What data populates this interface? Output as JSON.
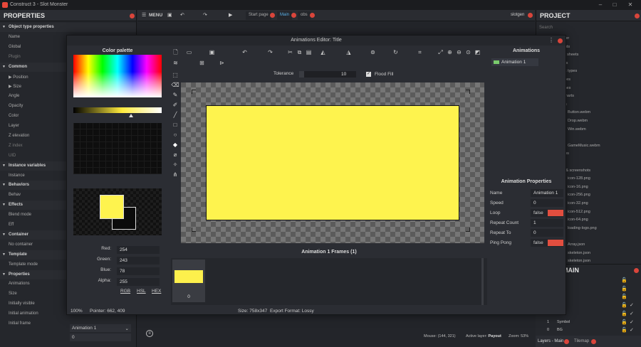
{
  "app": {
    "title": "Construct 3 - Slot Monster",
    "main_menu_label": "MENU",
    "tabs": [
      "Start page",
      "Main",
      "obs"
    ],
    "user": "slotgen",
    "status_mouse": "Mouse: (144, 321)",
    "status_layer_label": "Active layer:",
    "status_layer_value": "Payout",
    "status_zoom": "Zoom: 53%"
  },
  "properties": {
    "title": "PROPERTIES",
    "rows": [
      {
        "label": "Object type properties",
        "type": "section"
      },
      {
        "label": "Name",
        "type": "row"
      },
      {
        "label": "Global",
        "type": "row"
      },
      {
        "label": "Plugin",
        "type": "dim"
      },
      {
        "label": "Common",
        "type": "section"
      },
      {
        "label": "▶  Position",
        "type": "row"
      },
      {
        "label": "▶  Size",
        "type": "row"
      },
      {
        "label": "Angle",
        "type": "row"
      },
      {
        "label": "Opacity",
        "type": "row"
      },
      {
        "label": "Color",
        "type": "row"
      },
      {
        "label": "Layer",
        "type": "row"
      },
      {
        "label": "Z elevation",
        "type": "row"
      },
      {
        "label": "Z index",
        "type": "dim"
      },
      {
        "label": "UID",
        "type": "dim"
      },
      {
        "label": "Instance variables",
        "type": "section"
      },
      {
        "label": "Instance",
        "type": "row"
      },
      {
        "label": "Behaviors",
        "type": "section"
      },
      {
        "label": "Behav",
        "type": "row"
      },
      {
        "label": "Effects",
        "type": "section"
      },
      {
        "label": "Blend mode",
        "type": "row"
      },
      {
        "label": "Eff",
        "type": "row"
      },
      {
        "label": "Container",
        "type": "section"
      },
      {
        "label": "No container",
        "type": "row"
      },
      {
        "label": "Template",
        "type": "section"
      },
      {
        "label": "Template mode",
        "type": "row"
      },
      {
        "label": "Properties",
        "type": "section"
      },
      {
        "label": "Animations",
        "type": "row"
      },
      {
        "label": "Size",
        "type": "row"
      },
      {
        "label": "Initially visible",
        "type": "row"
      },
      {
        "label": "Initial animation",
        "type": "row"
      },
      {
        "label": "Initial frame",
        "type": "row"
      }
    ],
    "initial_animation_value": "Animation 1",
    "initial_frame_value": "0"
  },
  "project": {
    "title": "PROJECT",
    "search_placeholder": "Search",
    "items": [
      "nster",
      "youts",
      "ent sheets",
      "ripts",
      "ject types",
      "milies",
      "elines",
      "wcharts",
      "nds",
      "Button.webm",
      "Drop.webm",
      "Win.webm",
      "sic",
      "GameMusic.webm",
      "deos",
      "nts",
      "ns & screenshots",
      "icon-128.png",
      "icon-16.png",
      "icon-256.png",
      "icon-32.png",
      "icon-512.png",
      "icon-64.png",
      "loading-logo.png",
      "s",
      "Array.json",
      "skeleton.json",
      "skeleton.json"
    ]
  },
  "layers": {
    "title": "MAIN",
    "rows": [
      "",
      "",
      "otion",
      "Spin",
      "",
      "Symbol",
      "BG"
    ],
    "row_numbers": [
      "",
      "",
      "",
      "",
      "",
      "1",
      "0"
    ],
    "tab_layers": "Layers - Main",
    "tab_tilemap": "Tilemap"
  },
  "editor": {
    "title": "Animations Editor: Title",
    "palette_title": "Color palette",
    "tolerance_label": "Tolerance",
    "tolerance_value": "10",
    "flood_fill_label": "Flood Fill",
    "flood_fill_checked": true,
    "red_label": "Red:",
    "red_value": "254",
    "green_label": "Green:",
    "green_value": "243",
    "blue_label": "Blue:",
    "blue_value": "78",
    "alpha_label": "Alpha:",
    "alpha_value": "255",
    "mode_links": [
      "RGB",
      "HSL",
      "HEX"
    ],
    "fill_color": "#fef34e",
    "frames_header": "Animation 1 Frames (1)",
    "frames": [
      "0"
    ],
    "status_zoom": "100%",
    "status_pointer": "Pointer: 662, 409",
    "status_size": "Size: 758x347",
    "status_format": "Export Format: Lossy",
    "animations_header": "Animations",
    "animations": [
      "Animation 1"
    ],
    "anim_props_header": "Animation Properties",
    "anim_props": [
      {
        "key": "Name",
        "value": "Animation 1",
        "kind": "text"
      },
      {
        "key": "Speed",
        "value": "0",
        "kind": "text"
      },
      {
        "key": "Loop",
        "value": "false",
        "kind": "bool"
      },
      {
        "key": "Repeat Count",
        "value": "1",
        "kind": "text"
      },
      {
        "key": "Repeat To",
        "value": "0",
        "kind": "text"
      },
      {
        "key": "Ping Pong",
        "value": "false",
        "kind": "bool"
      }
    ]
  }
}
